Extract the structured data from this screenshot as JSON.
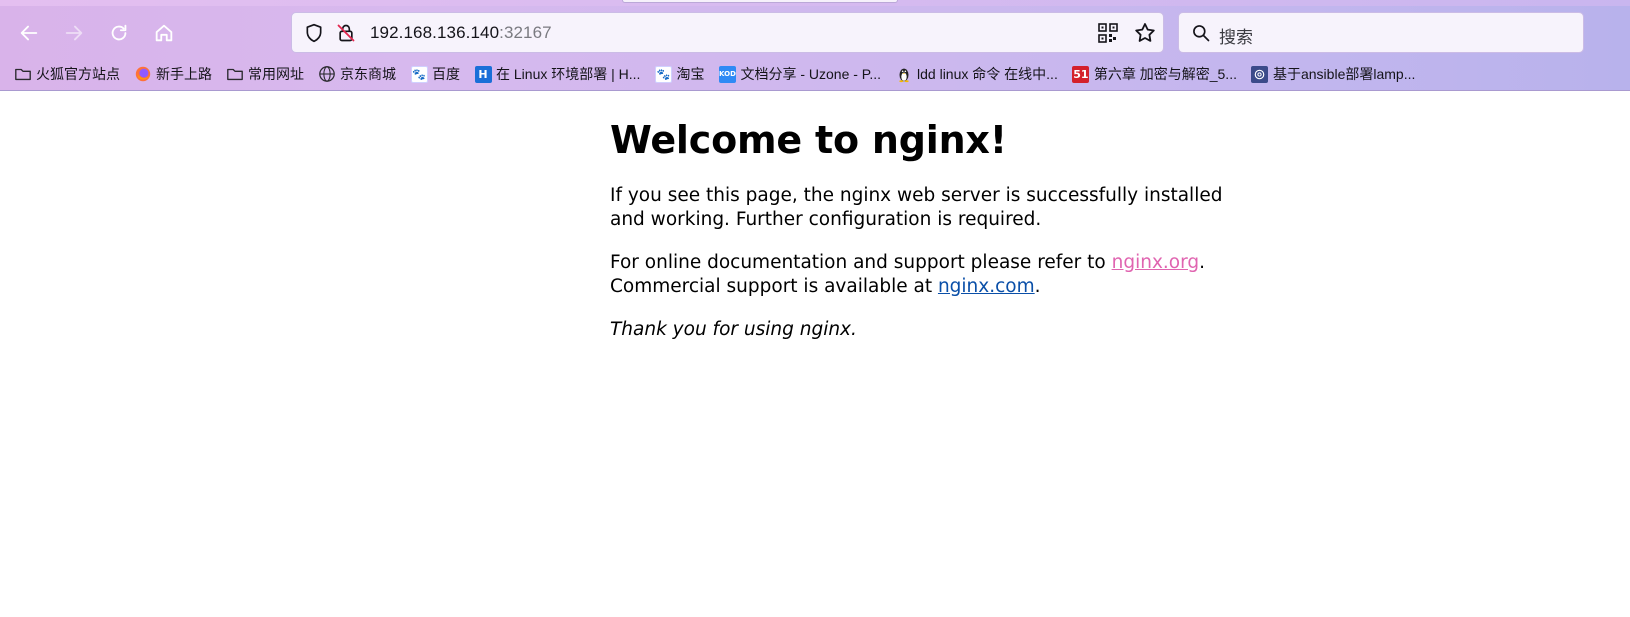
{
  "browser": {
    "nav": {
      "back": "back-arrow-icon",
      "forward": "forward-arrow-icon",
      "reload": "reload-icon",
      "home": "home-icon"
    },
    "url": {
      "host": "192.168.136.140",
      "port": ":32167"
    },
    "search": {
      "placeholder": "搜索"
    },
    "bookmarks": [
      {
        "label": "火狐官方站点",
        "icon": "folder-icon"
      },
      {
        "label": "新手上路",
        "icon": "firefox-icon"
      },
      {
        "label": "常用网址",
        "icon": "folder-icon"
      },
      {
        "label": "京东商城",
        "icon": "globe-icon"
      },
      {
        "label": "百度",
        "icon": "baidu-icon"
      },
      {
        "label": "在 Linux 环境部署 | H...",
        "icon": "h-icon"
      },
      {
        "label": "淘宝",
        "icon": "baidu-icon"
      },
      {
        "label": "文档分享 - Uzone - P...",
        "icon": "kod-icon"
      },
      {
        "label": "ldd linux 命令 在线中...",
        "icon": "penguin-icon"
      },
      {
        "label": "第六章 加密与解密_5...",
        "icon": "51cto-icon"
      },
      {
        "label": "基于ansible部署lamp...",
        "icon": "spiral-icon"
      }
    ],
    "colors": {
      "chrome_start": "#d9b3ea",
      "chrome_end": "#b8b2ec"
    }
  },
  "page": {
    "title": "Welcome to nginx!",
    "para1": "If you see this page, the nginx web server is successfully installed and working. Further configuration is required.",
    "para2_prefix": "For online documentation and support please refer to ",
    "link1": "nginx.org",
    "para2_mid": ".",
    "para3_prefix": "Commercial support is available at ",
    "link2": "nginx.com",
    "para3_suffix": ".",
    "thanks": "Thank you for using nginx.",
    "colors": {
      "visited_link": "#e064b0",
      "link": "#0a4fa8"
    }
  }
}
